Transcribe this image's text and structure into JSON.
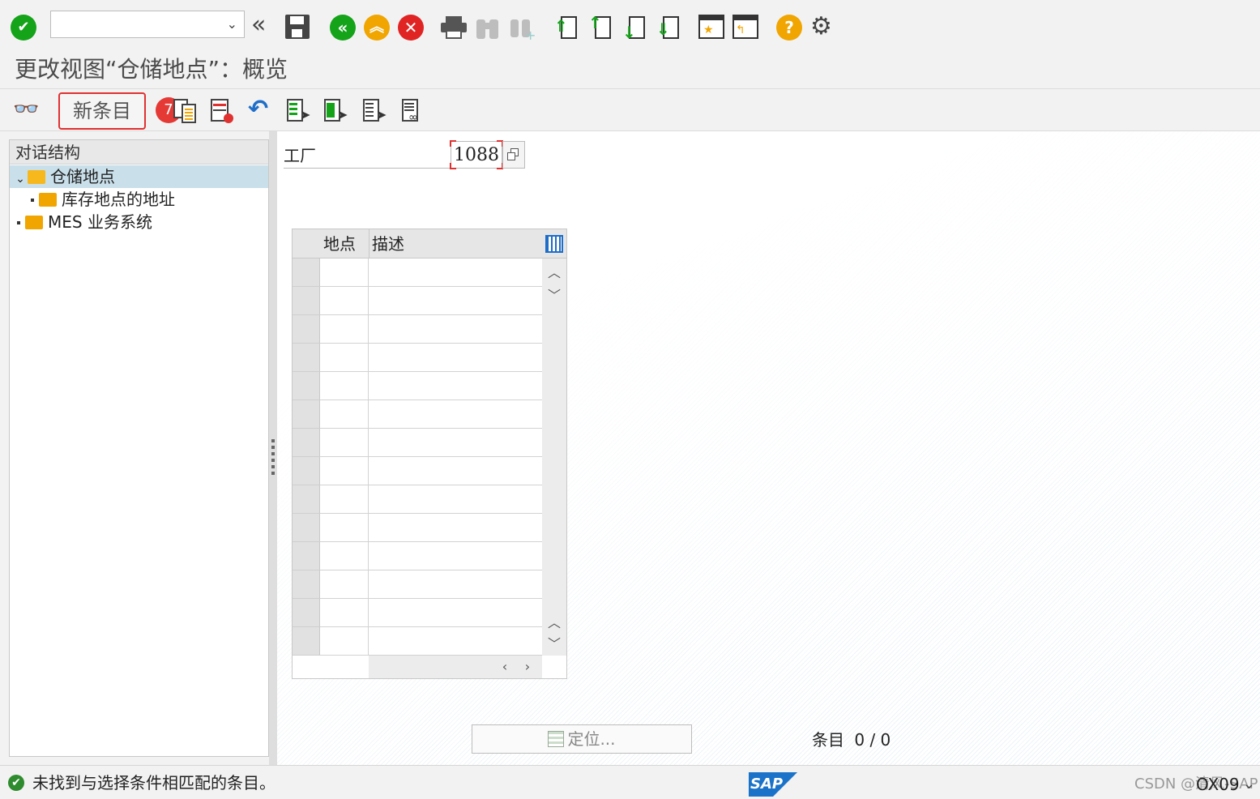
{
  "toolbar": {
    "command_field_value": "",
    "icons": [
      "enter-icon",
      "back-icon",
      "exit-icon",
      "cancel-icon",
      "save-icon",
      "print-icon",
      "find-icon",
      "find-next-icon",
      "first-page-icon",
      "previous-page-icon",
      "next-page-icon",
      "last-page-icon",
      "create-session-icon",
      "shortcut-icon",
      "help-icon",
      "settings-icon"
    ]
  },
  "title": "更改视图“仓储地点”：概览",
  "app_toolbar": {
    "new_entries_label": "新条目",
    "step_badge": "7"
  },
  "tree": {
    "header": "对话结构",
    "items": [
      {
        "label": "仓储地点",
        "level": 0,
        "expanded": true,
        "selected": true
      },
      {
        "label": "库存地点的地址",
        "level": 1,
        "expanded": false,
        "selected": false
      },
      {
        "label": "MES 业务系统",
        "level": 0,
        "expanded": false,
        "selected": false
      }
    ]
  },
  "main": {
    "plant_label": "工厂",
    "plant_value": "1088",
    "table": {
      "columns": [
        "地点",
        "描述"
      ],
      "rows": 14
    },
    "locate_button": "定位...",
    "entries_label": "条目",
    "entries_count": "0 / 0"
  },
  "status": {
    "message": "未找到与选择条件相匹配的条目。",
    "sap_logo": "SAP",
    "watermark": "CSDN @清风-SAP",
    "transaction": "OX09"
  },
  "colors": {
    "accent_green": "#14a319",
    "accent_orange": "#f0a500",
    "accent_red": "#e03131",
    "highlight": "#c9dfea"
  }
}
